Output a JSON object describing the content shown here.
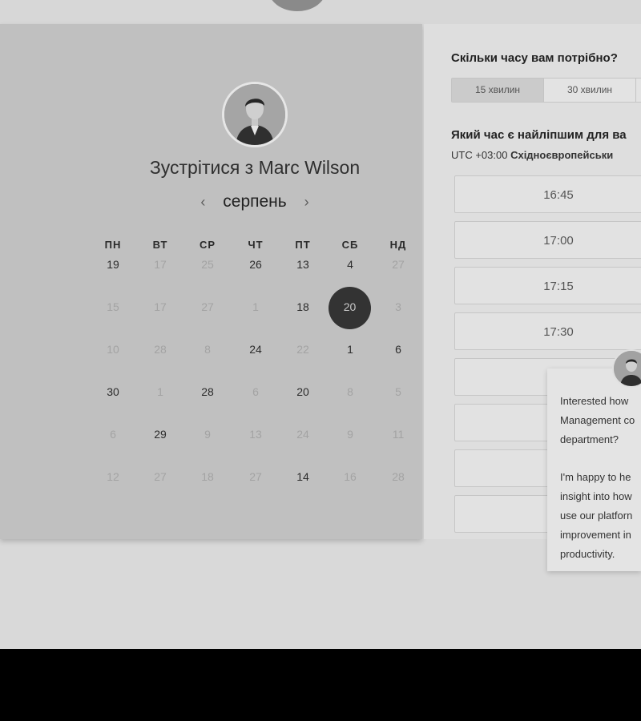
{
  "header": {
    "logo_icon": "speech-bubble-logo"
  },
  "calendar": {
    "title_prefix": "Зустрітися з",
    "host_name": "Marc Wilson",
    "month": "серпень",
    "prev_icon": "chevron-left-icon",
    "next_icon": "chevron-right-icon",
    "weekdays": [
      "ПН",
      "ВТ",
      "СР",
      "ЧТ",
      "ПТ",
      "СБ",
      "НД"
    ],
    "weeks": [
      [
        {
          "d": "19",
          "a": true
        },
        {
          "d": "17",
          "a": false
        },
        {
          "d": "25",
          "a": false
        },
        {
          "d": "26",
          "a": true
        },
        {
          "d": "13",
          "a": true
        },
        {
          "d": "4",
          "a": true
        },
        {
          "d": "27",
          "a": false
        }
      ],
      [
        {
          "d": "15",
          "a": false
        },
        {
          "d": "17",
          "a": false
        },
        {
          "d": "27",
          "a": false
        },
        {
          "d": "1",
          "a": false
        },
        {
          "d": "18",
          "a": true
        },
        {
          "d": "20",
          "a": true,
          "selected": true
        },
        {
          "d": "3",
          "a": false
        }
      ],
      [
        {
          "d": "10",
          "a": false
        },
        {
          "d": "28",
          "a": false
        },
        {
          "d": "8",
          "a": false
        },
        {
          "d": "24",
          "a": true
        },
        {
          "d": "22",
          "a": false
        },
        {
          "d": "1",
          "a": true
        },
        {
          "d": "6",
          "a": true
        }
      ],
      [
        {
          "d": "30",
          "a": true
        },
        {
          "d": "1",
          "a": false
        },
        {
          "d": "28",
          "a": true
        },
        {
          "d": "6",
          "a": false
        },
        {
          "d": "20",
          "a": true
        },
        {
          "d": "8",
          "a": false
        },
        {
          "d": "5",
          "a": false
        }
      ],
      [
        {
          "d": "6",
          "a": false
        },
        {
          "d": "29",
          "a": true
        },
        {
          "d": "9",
          "a": false
        },
        {
          "d": "13",
          "a": false
        },
        {
          "d": "24",
          "a": false
        },
        {
          "d": "9",
          "a": false
        },
        {
          "d": "11",
          "a": false
        }
      ],
      [
        {
          "d": "12",
          "a": false
        },
        {
          "d": "27",
          "a": false
        },
        {
          "d": "18",
          "a": false
        },
        {
          "d": "27",
          "a": false
        },
        {
          "d": "14",
          "a": true
        },
        {
          "d": "16",
          "a": false
        },
        {
          "d": "28",
          "a": false
        }
      ]
    ]
  },
  "booking": {
    "duration_question": "Скільки часу вам потрібно?",
    "durations": [
      "15 хвилин",
      "30 хвилин",
      ""
    ],
    "time_question": "Який час є найліпшим для ва",
    "tz_offset": "UTC +03:00",
    "tz_name": "Східноєвропейськи",
    "slots": [
      "16:45",
      "17:00",
      "17:15",
      "17:30",
      "",
      "",
      ""
    ]
  },
  "chat": {
    "avatar_icon": "person-avatar-icon",
    "lines_1": [
      "Interested how",
      "Management co",
      "department?"
    ],
    "lines_2": [
      "I'm happy to he",
      "insight into how",
      "use our platforn",
      "improvement in",
      "productivity."
    ]
  }
}
